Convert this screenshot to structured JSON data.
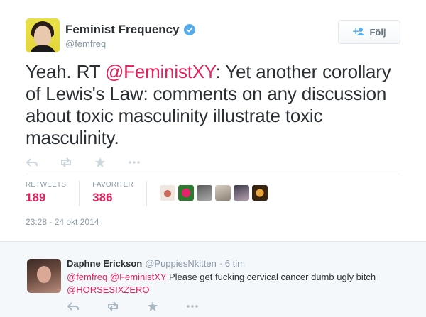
{
  "tweet": {
    "author": {
      "name": "Feminist Frequency",
      "handle": "@femfreq",
      "verified": true
    },
    "follow_label": "Följ",
    "text_parts": [
      "Yeah. RT ",
      "@FeministXY",
      ": Yet another corollary of Lewis's Law: comments on any discussion about toxic masculinity illustrate toxic masculinity."
    ],
    "actions": [
      "reply-icon",
      "retweet-icon",
      "favorite-icon",
      "more-icon"
    ],
    "stats": {
      "retweets_label": "RETWEETS",
      "retweets": "189",
      "favorites_label": "FAVORITER",
      "favorites": "386"
    },
    "timestamp": "23:28 - 24 okt 2014"
  },
  "reply": {
    "author": {
      "name": "Daphne Erickson",
      "handle": "@PuppiesNkitten",
      "time": "· 6 tim"
    },
    "text_parts": [
      "@femfreq",
      " ",
      "@FeministXY",
      " Please get fucking cervical cancer dumb ugly bitch",
      "@HORSESIXZERO"
    ],
    "actions": [
      "reply-icon",
      "retweet-icon",
      "favorite-icon",
      "more-icon"
    ]
  },
  "colors": {
    "accent": "#e0245e",
    "verified": "#55acee",
    "muted": "#8899a6"
  }
}
